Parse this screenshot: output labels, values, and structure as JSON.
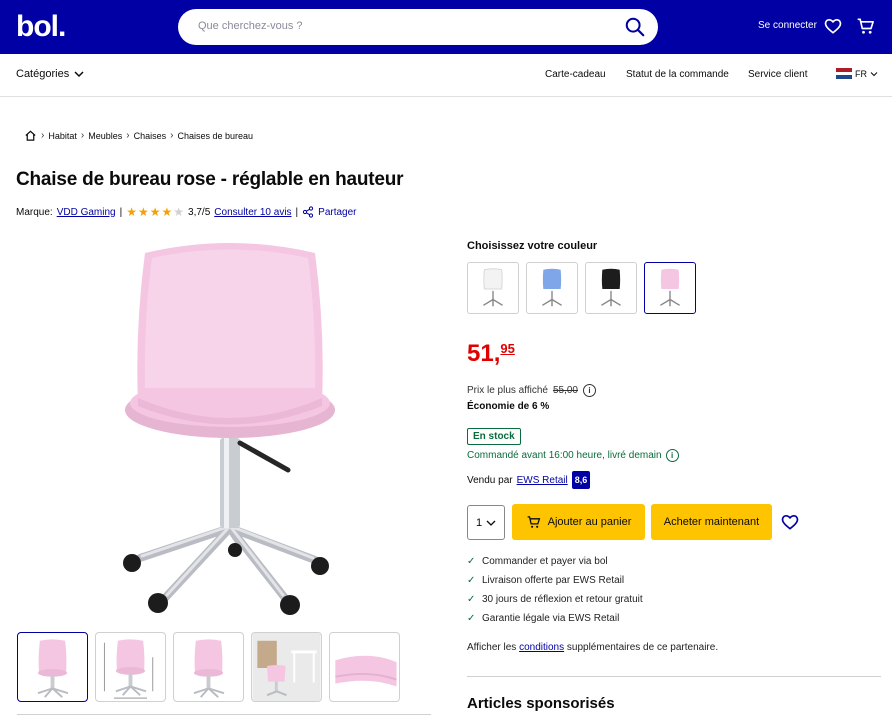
{
  "header": {
    "logo": "bol.",
    "search_placeholder": "Que cherchez-vous ?",
    "login_label": "Se connecter"
  },
  "subnav": {
    "categories_label": "Catégories",
    "links": [
      "Carte-cadeau",
      "Statut de la commande",
      "Service client"
    ],
    "language": "FR"
  },
  "breadcrumb": [
    "Habitat",
    "Meubles",
    "Chaises",
    "Chaises de bureau"
  ],
  "product": {
    "title": "Chaise de bureau rose - réglable en hauteur",
    "brand_label": "Marque:",
    "brand": "VDD Gaming",
    "rating": 3.7,
    "rating_text": "3,7/5",
    "reviews_link": "Consulter 10 avis",
    "share_label": "Partager",
    "color_label": "Choisissez votre couleur",
    "colors": [
      {
        "name": "white",
        "hex": "#f3f3f3"
      },
      {
        "name": "blue",
        "hex": "#7ea6e8"
      },
      {
        "name": "black",
        "hex": "#1d1d1d"
      },
      {
        "name": "pink",
        "hex": "#f4c6e2"
      }
    ],
    "price_main": "51,",
    "price_cents": "95",
    "ref_label": "Prix le plus affiché",
    "ref_price": "55,00",
    "saving": "Économie de 6 %",
    "stock": "En stock",
    "delivery": "Commandé avant 16:00 heure, livré demain",
    "sold_by_label": "Vendu par",
    "seller": "EWS Retail",
    "seller_rating": "8,6",
    "quantity": "1",
    "add_to_cart": "Ajouter au panier",
    "buy_now": "Acheter maintenant",
    "usps": [
      "Commander et payer via bol",
      "Livraison offerte par EWS Retail",
      "30 jours de réflexion et retour gratuit",
      "Garantie légale via EWS Retail"
    ],
    "conditions_prefix": "Afficher les",
    "conditions_link": "conditions",
    "conditions_suffix": "supplémentaires de ce partenaire.",
    "sponsored_title": "Articles sponsorisés"
  },
  "colors": {
    "brand": "#0000a4",
    "price": "#e00000",
    "cta": "#ffc400",
    "stock": "#0a6b3c",
    "chair_pink": "#f4c6e2"
  }
}
